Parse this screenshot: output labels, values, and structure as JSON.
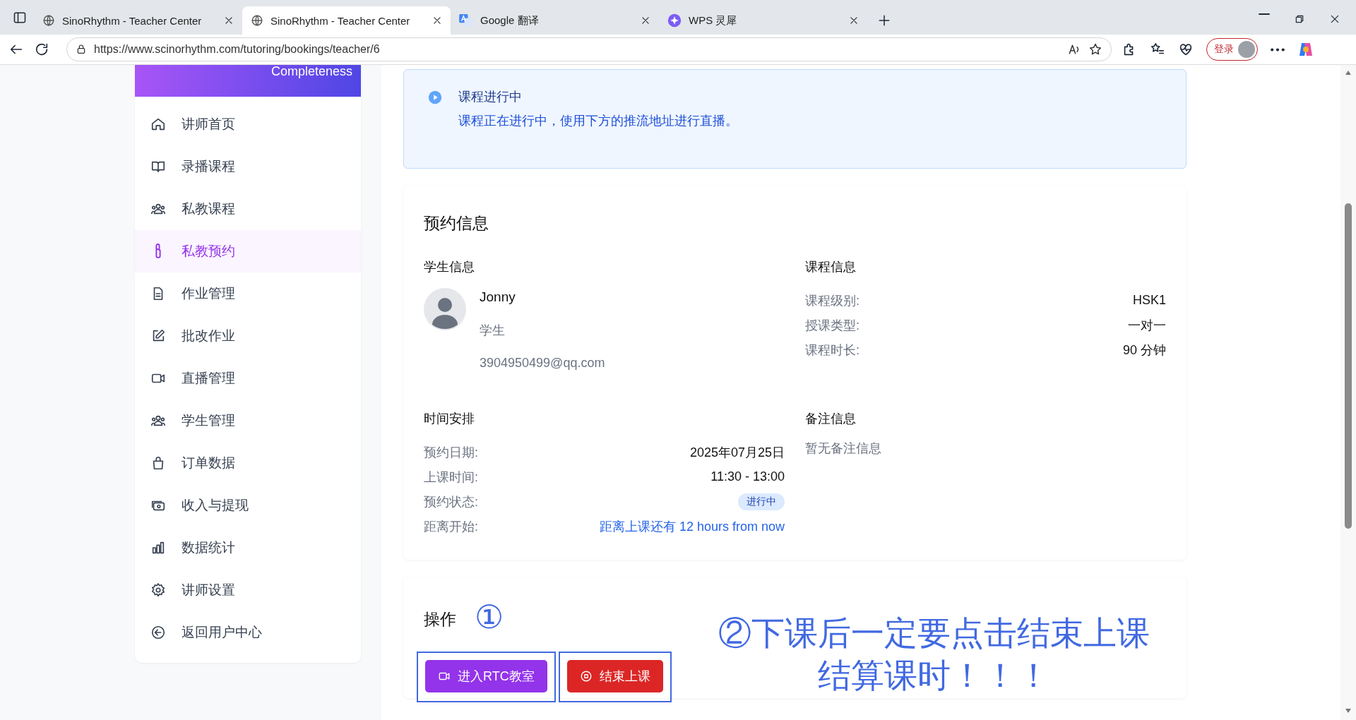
{
  "browser": {
    "tabs": [
      {
        "title": "SinoRhythm - Teacher Center",
        "selected": false
      },
      {
        "title": "SinoRhythm - Teacher Center",
        "selected": true
      },
      {
        "title": "Google 翻译",
        "selected": false
      },
      {
        "title": "WPS 灵犀",
        "selected": false
      }
    ],
    "url": "https://www.scinorhythm.com/tutoring/bookings/teacher/6",
    "login_label": "登录"
  },
  "sidebar": {
    "banner_text": "Completeness",
    "items": [
      {
        "label": "讲师首页",
        "selected": false
      },
      {
        "label": "录播课程",
        "selected": false
      },
      {
        "label": "私教课程",
        "selected": false
      },
      {
        "label": "私教预约",
        "selected": true
      },
      {
        "label": "作业管理",
        "selected": false
      },
      {
        "label": "批改作业",
        "selected": false
      },
      {
        "label": "直播管理",
        "selected": false
      },
      {
        "label": "学生管理",
        "selected": false
      },
      {
        "label": "订单数据",
        "selected": false
      },
      {
        "label": "收入与提现",
        "selected": false
      },
      {
        "label": "数据统计",
        "selected": false
      },
      {
        "label": "讲师设置",
        "selected": false
      },
      {
        "label": "返回用户中心",
        "selected": false
      }
    ]
  },
  "alert": {
    "title": "课程进行中",
    "message": "课程正在进行中，使用下方的推流地址进行直播。"
  },
  "booking": {
    "title": "预约信息",
    "student": {
      "heading": "学生信息",
      "name": "Jonny",
      "role": "学生",
      "email": "3904950499@qq.com"
    },
    "course": {
      "heading": "课程信息",
      "fields": [
        {
          "label": "课程级别:",
          "value": "HSK1"
        },
        {
          "label": "授课类型:",
          "value": "一对一"
        },
        {
          "label": "课程时长:",
          "value": "90 分钟"
        }
      ]
    },
    "schedule": {
      "heading": "时间安排",
      "fields": [
        {
          "label": "预约日期:",
          "value": "2025年07月25日",
          "kind": "text"
        },
        {
          "label": "上课时间:",
          "value": "11:30 - 13:00",
          "kind": "text"
        },
        {
          "label": "预约状态:",
          "value": "进行中",
          "kind": "badge"
        },
        {
          "label": "距离开始:",
          "value": "距离上课还有 12 hours from now",
          "kind": "link"
        }
      ]
    },
    "notes": {
      "heading": "备注信息",
      "text": "暂无备注信息"
    }
  },
  "actions": {
    "title": "操作",
    "step_mark": "①",
    "buttons": [
      {
        "label": "进入RTC教室",
        "kind": "primary",
        "annotated": true
      },
      {
        "label": "结束上课",
        "kind": "danger",
        "annotated": true
      }
    ],
    "note_lines": [
      "②下课后一定要点击结束上课",
      "结算课时！！！"
    ]
  }
}
